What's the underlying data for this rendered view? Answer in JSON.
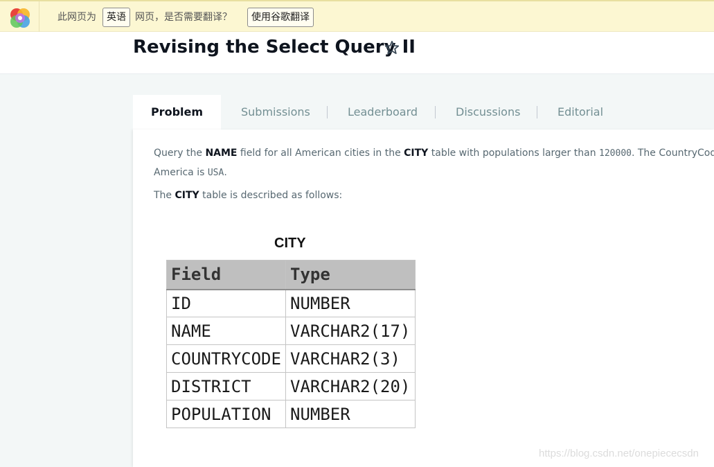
{
  "translate_bar": {
    "prefix": "此网页为",
    "language_button": "英语",
    "question": "网页，是否需要翻译？",
    "translate_button": "使用谷歌翻译"
  },
  "header": {
    "title": "Revising the Select Query II"
  },
  "tabs": [
    {
      "label": "Problem",
      "active": true
    },
    {
      "label": "Submissions",
      "active": false
    },
    {
      "label": "Leaderboard",
      "active": false
    },
    {
      "label": "Discussions",
      "active": false
    },
    {
      "label": "Editorial",
      "active": false
    }
  ],
  "problem": {
    "p1_a": "Query the ",
    "p1_b": "NAME",
    "p1_c": " field for all American cities in the ",
    "p1_d": "CITY",
    "p1_e": " table with populations larger than ",
    "p1_f": "120000",
    "p1_g": ". The CountryCode for",
    "p1_h": "America is ",
    "p1_i": "USA",
    "p1_j": ".",
    "p2_a": "The ",
    "p2_b": "CITY",
    "p2_c": " table is described as follows:"
  },
  "city_table": {
    "caption": "CITY",
    "headers": [
      "Field",
      "Type"
    ],
    "rows": [
      [
        "ID",
        "NUMBER"
      ],
      [
        "NAME",
        "VARCHAR2(17)"
      ],
      [
        "COUNTRYCODE",
        "VARCHAR2(3)"
      ],
      [
        "DISTRICT",
        "VARCHAR2(20)"
      ],
      [
        "POPULATION",
        "NUMBER"
      ]
    ]
  },
  "watermark": "https://blog.csdn.net/onepiececsdn",
  "colors": {
    "translate_bar_bg": "#fcf7d2",
    "page_bg": "#f3f7f7",
    "tab_inactive": "#738f93",
    "title": "#0e141e"
  }
}
